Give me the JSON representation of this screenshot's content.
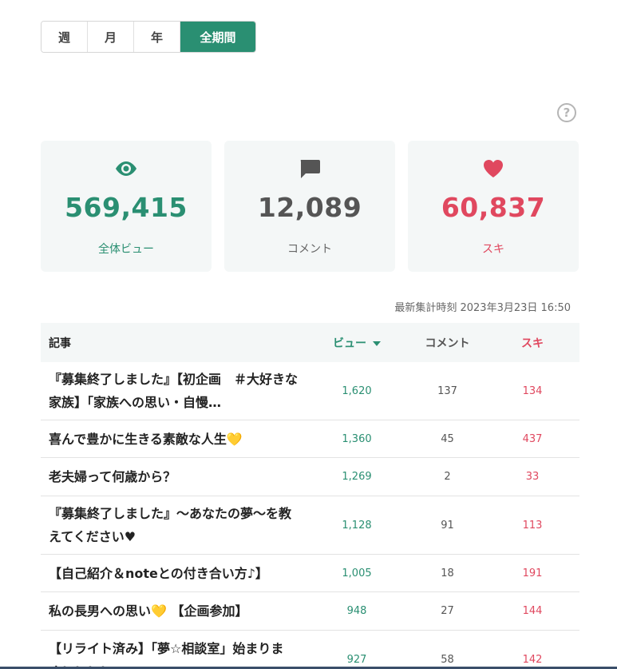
{
  "period": {
    "tabs": [
      "週",
      "月",
      "年",
      "全期間"
    ],
    "active": "全期間"
  },
  "help": {
    "icon": "help-circle-icon",
    "glyph": "?"
  },
  "stats": {
    "views": {
      "value": "569,415",
      "label": "全体ビュー",
      "icon": "eye-icon",
      "color": "#2a8f72"
    },
    "comments": {
      "value": "12,089",
      "label": "コメント",
      "icon": "comment-icon",
      "color": "#555555"
    },
    "likes": {
      "value": "60,837",
      "label": "スキ",
      "icon": "heart-icon",
      "color": "#e0485f"
    }
  },
  "updated": "最新集計時刻 2023年3月23日 16:50",
  "table": {
    "headers": {
      "title": "記事",
      "views": "ビュー",
      "comments": "コメント",
      "likes": "スキ"
    },
    "rows": [
      {
        "title": "『募集終了しました』【初企画　＃大好きな家族】「家族への思い・自慢…",
        "views": "1,620",
        "comments": "137",
        "likes": "134"
      },
      {
        "title": "喜んで豊かに生きる素敵な人生💛",
        "views": "1,360",
        "comments": "45",
        "likes": "437"
      },
      {
        "title": "老夫婦って何歳から？",
        "views": "1,269",
        "comments": "2",
        "likes": "33"
      },
      {
        "title": "『募集終了しました』～あなたの夢～を教えてください♥",
        "views": "1,128",
        "comments": "91",
        "likes": "113"
      },
      {
        "title": "【自己紹介＆noteとの付き合い方♪】",
        "views": "1,005",
        "comments": "18",
        "likes": "191"
      },
      {
        "title": "私の長男への思い💛 【企画参加】",
        "views": "948",
        "comments": "27",
        "likes": "144"
      },
      {
        "title": "【リライト済み】「夢☆相談室」始まります！！！！",
        "views": "927",
        "comments": "58",
        "likes": "142"
      }
    ]
  }
}
